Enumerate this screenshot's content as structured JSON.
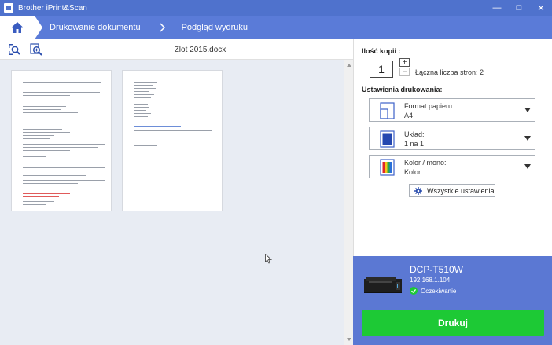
{
  "window": {
    "title": "Brother iPrint&Scan",
    "minimize_glyph": "—",
    "maximize_glyph": "□",
    "close_glyph": "✕"
  },
  "nav": {
    "home_icon": "home-icon",
    "crumb1": "Drukowanie dokumentu",
    "crumb2": "Podgląd wydruku"
  },
  "toolbar": {
    "zoom_fit_icon": "zoom-fit-icon",
    "zoom_in_icon": "zoom-in-icon",
    "document_name": "Zlot 2015.docx"
  },
  "panel": {
    "copies_label": "Ilość kopii :",
    "copies_value": "1",
    "plus": "+",
    "minus": "−",
    "total_pages": "Łączna liczba stron: 2",
    "settings_label": "Ustawienia drukowania:",
    "settings": [
      {
        "name": "Format papieru :",
        "value": "A4",
        "icon": "paper-size-icon"
      },
      {
        "name": "Układ:",
        "value": "1 na 1",
        "icon": "layout-icon"
      },
      {
        "name": "Kolor / mono:",
        "value": "Kolor",
        "icon": "color-icon"
      }
    ],
    "all_settings": "Wszystkie ustawienia"
  },
  "printer": {
    "name": "DCP-T510W",
    "ip": "192.168.1.104",
    "status": "Oczekiwanie",
    "print_label": "Drukuj"
  },
  "colors": {
    "titlebar": "#4f72cd",
    "navbar": "#5a7bd8",
    "printer_area": "#5b78d3",
    "print_button": "#1dc935"
  }
}
